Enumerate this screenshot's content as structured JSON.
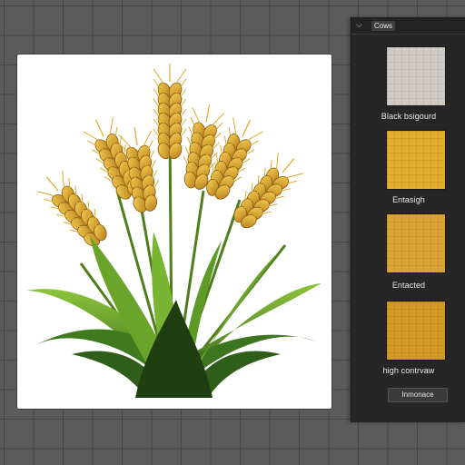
{
  "panel": {
    "title": "Cows",
    "swatches": [
      {
        "label": "Black bsigourd",
        "color": "#cfcac4"
      },
      {
        "label": "Entasigh",
        "color": "#e2ad2e"
      },
      {
        "label": "Entacted",
        "color": "#dba334"
      },
      {
        "label": "high contrvaw",
        "color": "#d39826"
      }
    ],
    "action_button": "Inmonace"
  },
  "icons": {
    "collapse": "chevron-down-icon"
  },
  "colors": {
    "panel_bg": "#262626",
    "workspace_bg": "#5b5b5b",
    "wheat_gold": "#e2ad2e",
    "leaf_green": "#5f9a22"
  }
}
